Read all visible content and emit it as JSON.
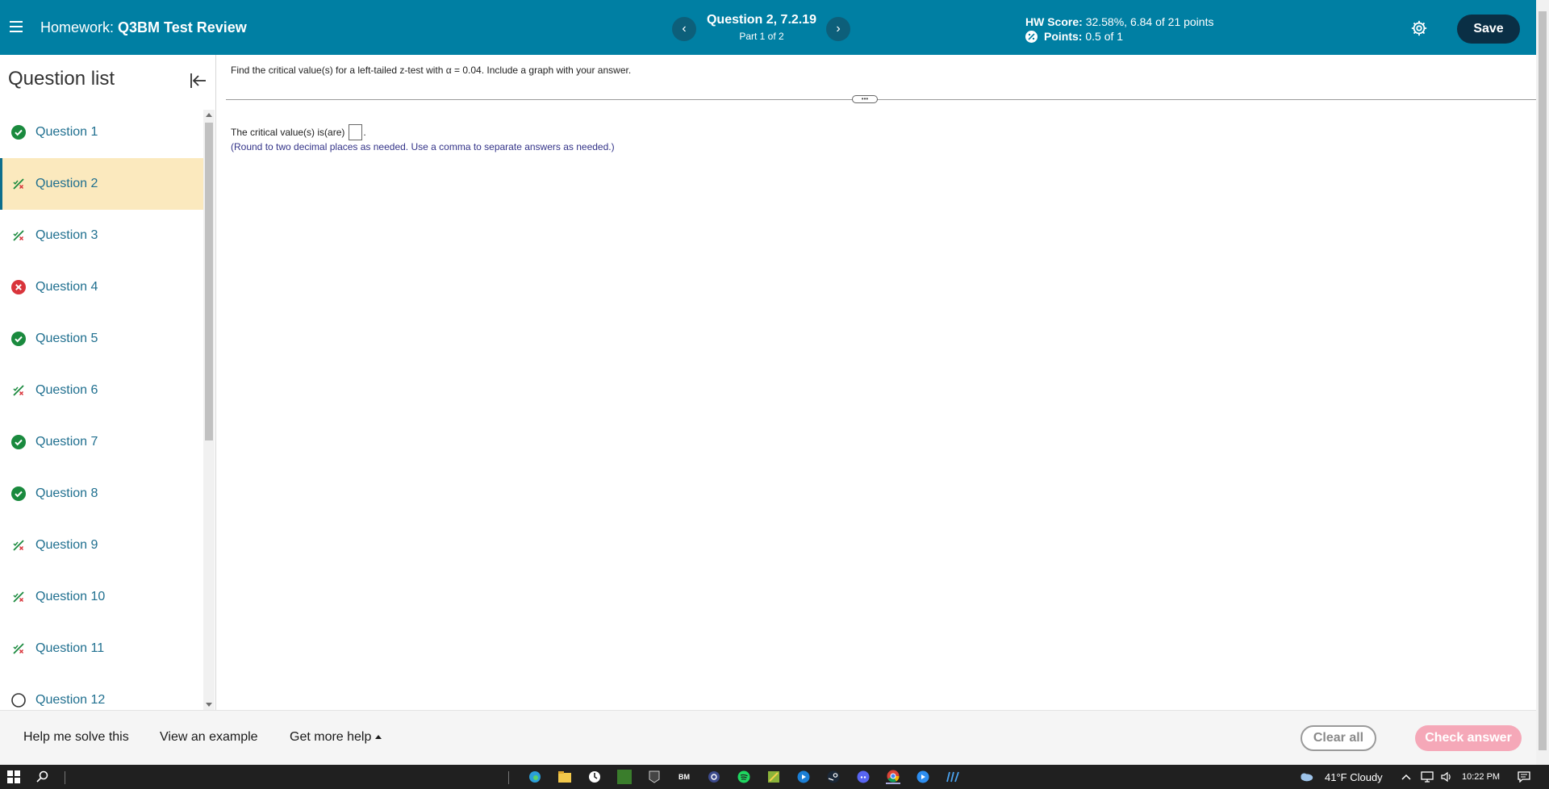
{
  "header": {
    "homework_label": "Homework:",
    "homework_name": "Q3BM Test Review",
    "question_title": "Question 2, 7.2.19",
    "question_part": "Part 1 of 2",
    "hw_score_label": "HW Score:",
    "hw_score_value": "32.58%, 6.84 of 21 points",
    "points_label": "Points:",
    "points_value": "0.5 of 1",
    "save_label": "Save",
    "prev_glyph": "‹",
    "next_glyph": "›"
  },
  "sidebar": {
    "title": "Question list",
    "items": [
      {
        "label": "Question 1",
        "status": "correct"
      },
      {
        "label": "Question 2",
        "status": "partial"
      },
      {
        "label": "Question 3",
        "status": "partial"
      },
      {
        "label": "Question 4",
        "status": "incorrect"
      },
      {
        "label": "Question 5",
        "status": "correct"
      },
      {
        "label": "Question 6",
        "status": "partial"
      },
      {
        "label": "Question 7",
        "status": "correct"
      },
      {
        "label": "Question 8",
        "status": "correct"
      },
      {
        "label": "Question 9",
        "status": "partial"
      },
      {
        "label": "Question 10",
        "status": "partial"
      },
      {
        "label": "Question 11",
        "status": "partial"
      },
      {
        "label": "Question 12",
        "status": "unanswered"
      }
    ]
  },
  "main": {
    "question_text": "Find the critical value(s) for a left-tailed z-test with α = 0.04. Include a graph with your answer.",
    "answer_prefix": "The critical value(s) is(are)",
    "answer_suffix": ".",
    "hint": "(Round to two decimal places as needed. Use a comma to separate answers as needed.)",
    "splitter_glyph": "•••"
  },
  "footer": {
    "help_solve": "Help me solve this",
    "view_example": "View an example",
    "more_help": "Get more help",
    "clear_all": "Clear all",
    "check_answer": "Check answer"
  },
  "taskbar": {
    "weather": "41°F  Cloudy",
    "time": "10:22 PM",
    "bm_label": "BM"
  },
  "colors": {
    "header_bg": "#007fa3",
    "save_bg": "#0a2f45",
    "correct": "#1a8a3e",
    "partial": "#1a8a3e",
    "incorrect": "#d9343b",
    "active_row": "#fbe9be",
    "check_btn": "#f5a8b8"
  }
}
